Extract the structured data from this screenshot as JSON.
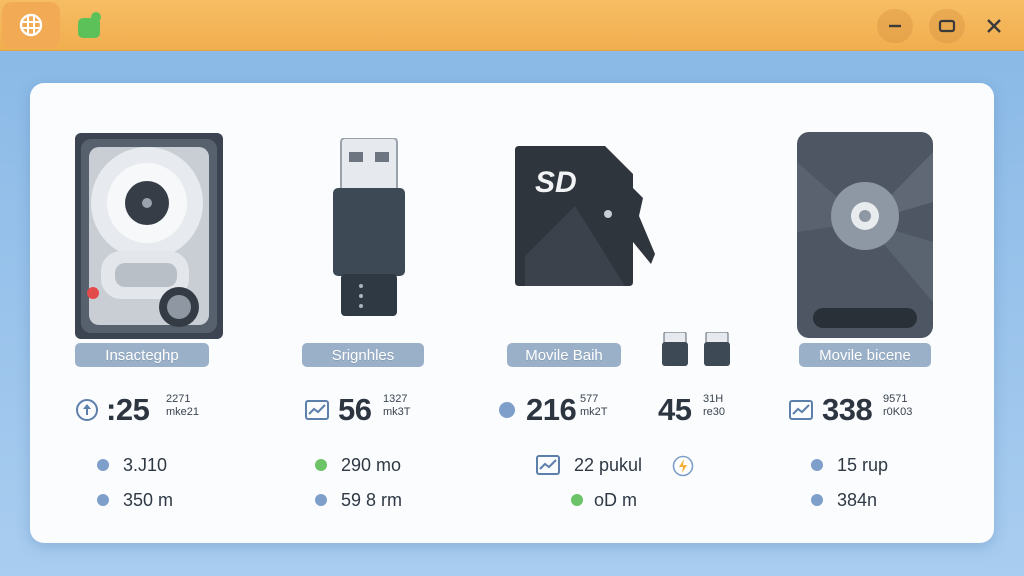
{
  "colors": {
    "titlebar": "#f2b35a",
    "pill": "#9ab0c8",
    "dot_blue": "#7e9fca",
    "dot_green": "#6cc368",
    "device_dark": "#3e4753"
  },
  "titlebar": {
    "app_icon": "globe-grid-icon",
    "secondary_icon": "leaf-icon",
    "controls": [
      "minimize-icon",
      "restore-icon",
      "close-icon"
    ]
  },
  "devices": [
    {
      "icon": "hard-drive-icon",
      "label": "Insacteghp",
      "status_icon": "refresh-circle-icon",
      "big_value": ":25",
      "sub_top": "2271",
      "sub_bottom": "mke21",
      "stats": [
        {
          "dot": "blue",
          "text": "3.J10"
        },
        {
          "dot": "blue",
          "text": "350 m"
        }
      ]
    },
    {
      "icon": "usb-drive-icon",
      "label": "Srignhles",
      "status_icon": "chart-icon",
      "big_value": "56",
      "sub_top": "1327",
      "sub_bottom": "mk3T",
      "stats": [
        {
          "dot": "green",
          "text": "290 mo"
        },
        {
          "dot": "blue",
          "text": "59 8 rm"
        }
      ]
    },
    {
      "icon": "sd-card-icon",
      "label": "Movile Baih",
      "status_icon": "blue-dot",
      "big_value": "216",
      "sub_top": "577",
      "sub_bottom": "mk2T",
      "card_text": "SD",
      "stats": [
        {
          "dot": "icon",
          "text": "22 pukul"
        },
        {
          "dot": "green",
          "text": "oD m"
        }
      ]
    },
    {
      "icon": "mini-usb-pair-icon",
      "big_value": "45",
      "sub_top": "31H",
      "sub_bottom": "re30",
      "badge_icon": "bolt-circle-icon"
    },
    {
      "icon": "ssd-drive-icon",
      "label": "Movile bicene",
      "status_icon": "chart-icon",
      "big_value": "338",
      "sub_top": "9571",
      "sub_bottom": "r0K03",
      "stats": [
        {
          "dot": "blue",
          "text": "15 rup"
        },
        {
          "dot": "blue",
          "text": "384n"
        }
      ]
    }
  ]
}
